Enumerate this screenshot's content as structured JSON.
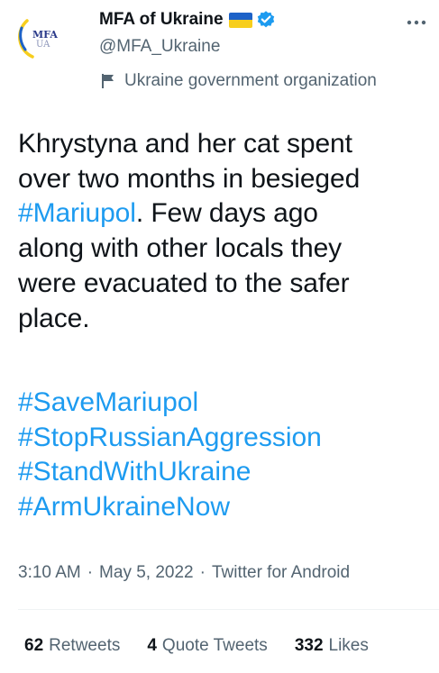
{
  "account": {
    "display_name": "MFA of Ukraine",
    "handle": "@MFA_Ukraine",
    "label": "Ukraine government organization",
    "avatar_text_top": "MFA",
    "avatar_text_bottom": "UA",
    "flag_colors": [
      "#1d62c8",
      "#f7ce1d"
    ],
    "verified_color": "#1d9bf0"
  },
  "tweet": {
    "lines": [
      {
        "text": "Khrystyna and her cat spent"
      },
      {
        "text": "over two months in besieged"
      },
      {
        "hashtag": "#Mariupol",
        "text": ". Few days ago"
      },
      {
        "text": "along with other locals they"
      },
      {
        "text": "were evacuated to the safer"
      },
      {
        "text": "place."
      }
    ],
    "hashtags": [
      "#SaveMariupol",
      "#StopRussianAggression",
      "#StandWithUkraine",
      "#ArmUkraineNow"
    ]
  },
  "meta": {
    "time": "3:10 AM",
    "separator": "·",
    "date": "May 5, 2022",
    "source": "Twitter for Android"
  },
  "stats": {
    "retweets_count": "62",
    "retweets_label": "Retweets",
    "quotes_count": "4",
    "quotes_label": "Quote Tweets",
    "likes_count": "332",
    "likes_label": "Likes"
  },
  "icons": {
    "more": "more-options-icon",
    "label": "flag-icon",
    "verified": "verified-badge-icon"
  },
  "colors": {
    "link": "#1d9bf0",
    "secondary_text": "#536471",
    "primary_text": "#0f1419",
    "divider": "#eff3f4"
  }
}
